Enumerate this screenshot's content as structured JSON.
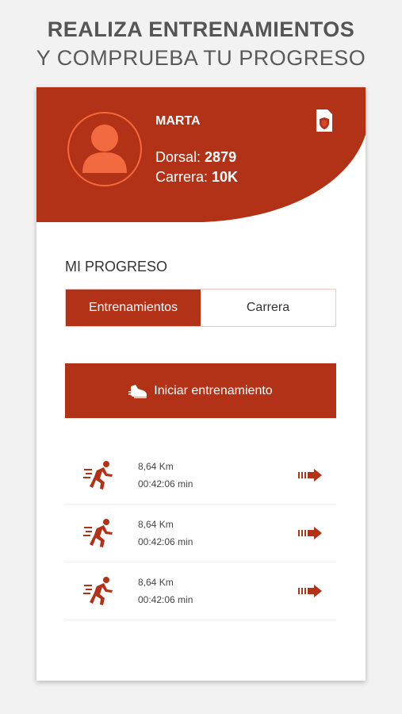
{
  "promo": {
    "line1": "REALIZA ENTRENAMIENTOS",
    "line2": "Y COMPRUEBA TU PROGRESO"
  },
  "profile": {
    "name": "MARTA",
    "dorsal_label": "Dorsal:",
    "dorsal_value": "2879",
    "carrera_label": "Carrera:",
    "carrera_value": "10K"
  },
  "progress": {
    "title": "MI PROGRESO",
    "tabs": [
      {
        "label": "Entrenamientos",
        "active": true
      },
      {
        "label": "Carrera",
        "active": false
      }
    ]
  },
  "start_button": {
    "label": "Iniciar entrenamiento",
    "icon": "running-shoe-icon"
  },
  "trainings": [
    {
      "distance": "8,64 Km",
      "time": "00:42:06 min"
    },
    {
      "distance": "8,64 Km",
      "time": "00:42:06 min"
    },
    {
      "distance": "8,64 Km",
      "time": "00:42:06 min"
    }
  ],
  "colors": {
    "brand": "#b13217",
    "avatar": "#f26a3f"
  }
}
